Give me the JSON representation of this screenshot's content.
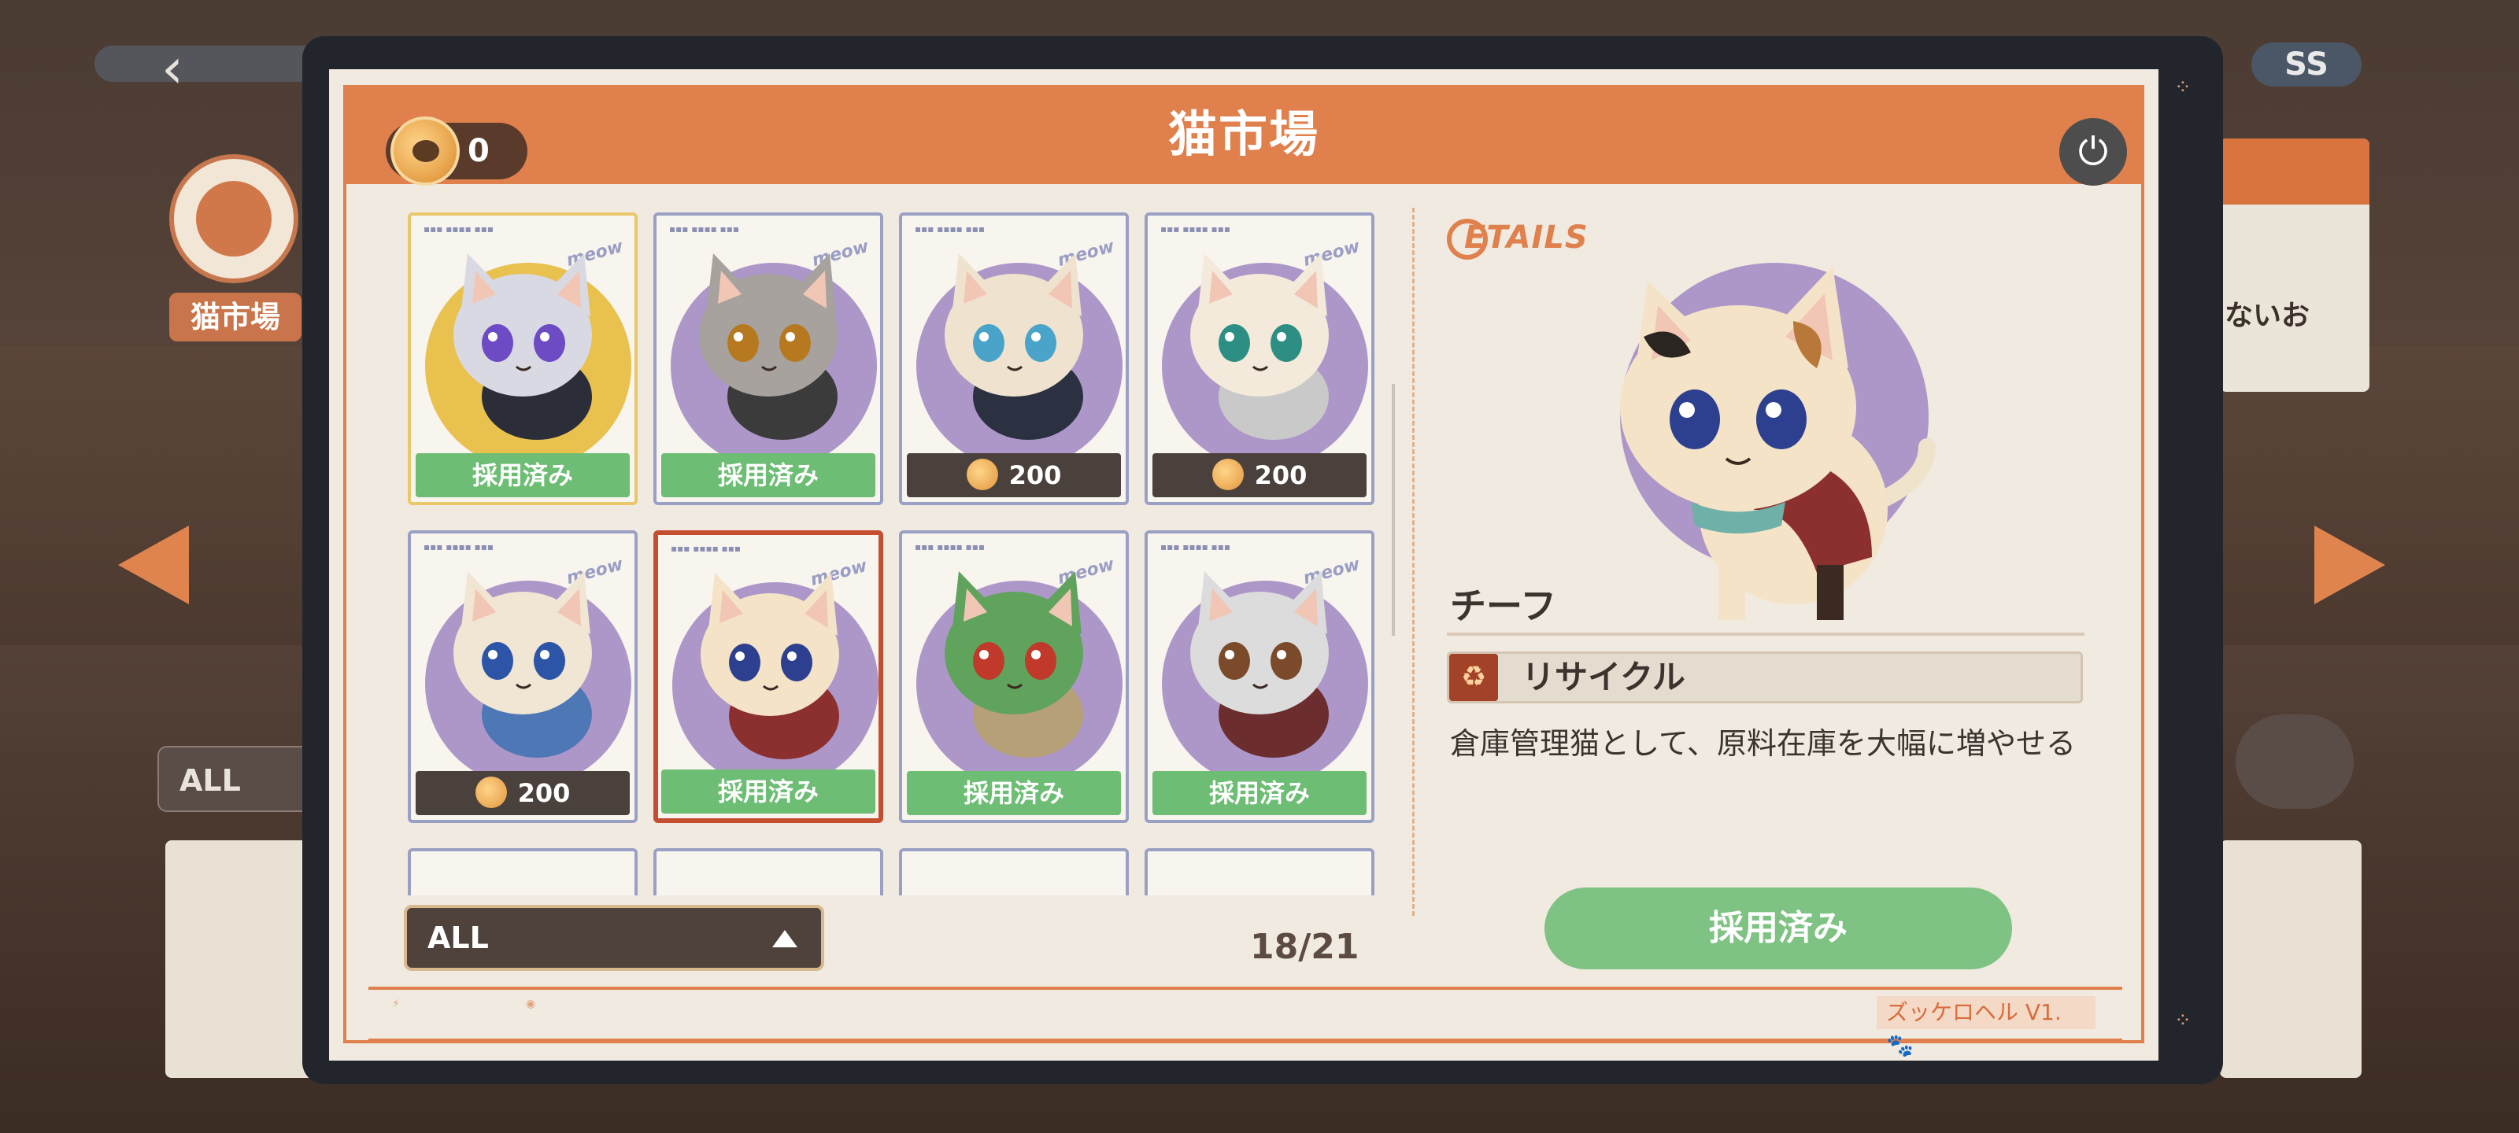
{
  "background": {
    "market_label": "猫市場",
    "filter_label": "ALL",
    "rank_label": "SS",
    "right_panel_text": "ないお"
  },
  "header": {
    "title": "猫市場",
    "coins": "0",
    "power_icon": "power-icon"
  },
  "grid": {
    "cards": [
      {
        "status": "採用済み",
        "type": "adopted",
        "theme": "gold",
        "fur": "#d9d9e3",
        "eyes": "#6c4bc4",
        "accent": "#2b2d38"
      },
      {
        "status": "採用済み",
        "type": "adopted",
        "theme": "purple",
        "fur": "#a8a29e",
        "eyes": "#b7791f",
        "accent": "#3b3b3b"
      },
      {
        "status": "200",
        "type": "price",
        "theme": "purple",
        "fur": "#efe3cf",
        "eyes": "#4aa3c9",
        "accent": "#2b3140"
      },
      {
        "status": "200",
        "type": "price",
        "theme": "purple",
        "fur": "#f3eadb",
        "eyes": "#2d8f84",
        "accent": "#c9c9c9"
      },
      {
        "status": "200",
        "type": "price",
        "theme": "purple",
        "fur": "#f1e6d3",
        "eyes": "#2c55a8",
        "accent": "#4d77b5"
      },
      {
        "status": "採用済み",
        "type": "adopted",
        "theme": "purple",
        "fur": "#f4e3c7",
        "eyes": "#2d3f8f",
        "accent": "#8c2f2f",
        "selected": true
      },
      {
        "status": "採用済み",
        "type": "adopted",
        "theme": "purple",
        "fur": "#5fa35c",
        "eyes": "#c0392b",
        "accent": "#b6a077"
      },
      {
        "status": "採用済み",
        "type": "adopted",
        "theme": "purple",
        "fur": "#dcdcdc",
        "eyes": "#7a4a2a",
        "accent": "#6b2d2d"
      }
    ]
  },
  "filter": {
    "label": "ALL"
  },
  "page_count": "18/21",
  "details": {
    "logo": "ETAILS",
    "cat_name": "チーフ",
    "skill_name": "リサイクル",
    "description": "倉庫管理猫として、原料在庫を大幅に増やせる",
    "adopt_button": "採用済み"
  },
  "footer": {
    "tag": "ズッケロヘル V1."
  }
}
